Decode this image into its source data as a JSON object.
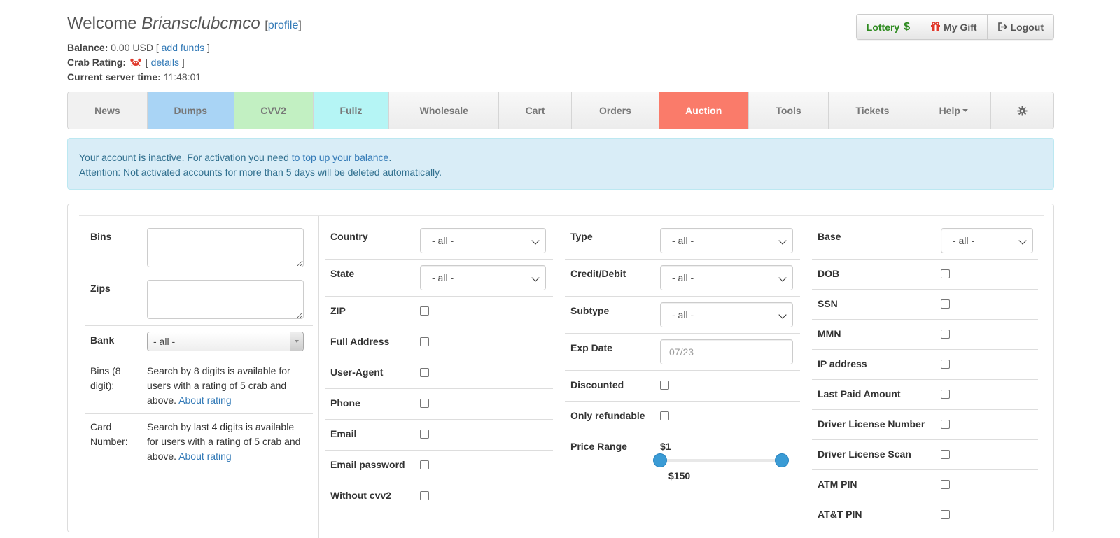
{
  "header": {
    "welcome_prefix": "Welcome",
    "username": "Briansclubcmco",
    "profile_link": "profile",
    "balance_label": "Balance:",
    "balance_value": "0.00 USD",
    "add_funds": "add funds",
    "crab_label": "Crab Rating:",
    "details_link": "details",
    "time_label": "Current server time:",
    "time_value": "11:48:01"
  },
  "top_buttons": {
    "lottery": "Lottery",
    "lottery_symbol": "$",
    "gift": "My Gift",
    "logout": "Logout"
  },
  "nav": [
    {
      "label": "News",
      "color": "#f1f1f1"
    },
    {
      "label": "Dumps",
      "color": "#a9d4f5"
    },
    {
      "label": "CVV2",
      "color": "#c2f0c2"
    },
    {
      "label": "Fullz",
      "color": "#b5f5f5"
    },
    {
      "label": "Wholesale",
      "color": "#f1f1f1"
    },
    {
      "label": "Cart",
      "color": "#f1f1f1"
    },
    {
      "label": "Orders",
      "color": "#f1f1f1"
    },
    {
      "label": "Auction",
      "color": "#fa7b6a"
    },
    {
      "label": "Tools",
      "color": "#f1f1f1"
    },
    {
      "label": "Tickets",
      "color": "#f1f1f1"
    },
    {
      "label": "Help",
      "color": "#f1f1f1"
    }
  ],
  "alert": {
    "line1_text": "Your account is inactive. For activation you need",
    "line1_link": "to top up your balance",
    "line1_end": ".",
    "line2": "Attention: Not activated accounts for more than 5 days will be deleted automatically."
  },
  "filters": {
    "col1": {
      "bins_label": "Bins",
      "zips_label": "Zips",
      "bank_label": "Bank",
      "bank_value": "- all -",
      "bins8_label": "Bins (8 digit):",
      "bins8_desc": "Search by 8 digits is available for users with a rating of 5 crab and above.",
      "bins8_link": "About rating",
      "card_label": "Card Number:",
      "card_desc": "Search by last 4 digits is available for users with a rating of 5 crab and above.",
      "card_link": "About rating"
    },
    "col2": {
      "country_label": "Country",
      "country_value": "- all -",
      "state_label": "State",
      "state_value": "- all -",
      "checks": [
        "ZIP",
        "Full Address",
        "User-Agent",
        "Phone",
        "Email",
        "Email password",
        "Without cvv2"
      ]
    },
    "col3": {
      "type_label": "Type",
      "type_value": "- all -",
      "credit_label": "Credit/Debit",
      "credit_value": "- all -",
      "subtype_label": "Subtype",
      "subtype_value": "- all -",
      "exp_label": "Exp Date",
      "exp_placeholder": "07/23",
      "discounted_label": "Discounted",
      "refundable_label": "Only refundable",
      "price_label": "Price Range",
      "price_min": "$1",
      "price_max": "$150"
    },
    "col4": {
      "base_label": "Base",
      "base_value": "- all -",
      "checks": [
        "DOB",
        "SSN",
        "MMN",
        "IP address",
        "Last Paid Amount",
        "Driver License Number",
        "Driver License Scan",
        "ATM PIN",
        "AT&T PIN"
      ]
    }
  },
  "colors": {
    "accent_link": "#337ab7",
    "alert_bg": "#d9edf7",
    "alert_text": "#31708f",
    "slider_handle": "#3a9bd5"
  }
}
